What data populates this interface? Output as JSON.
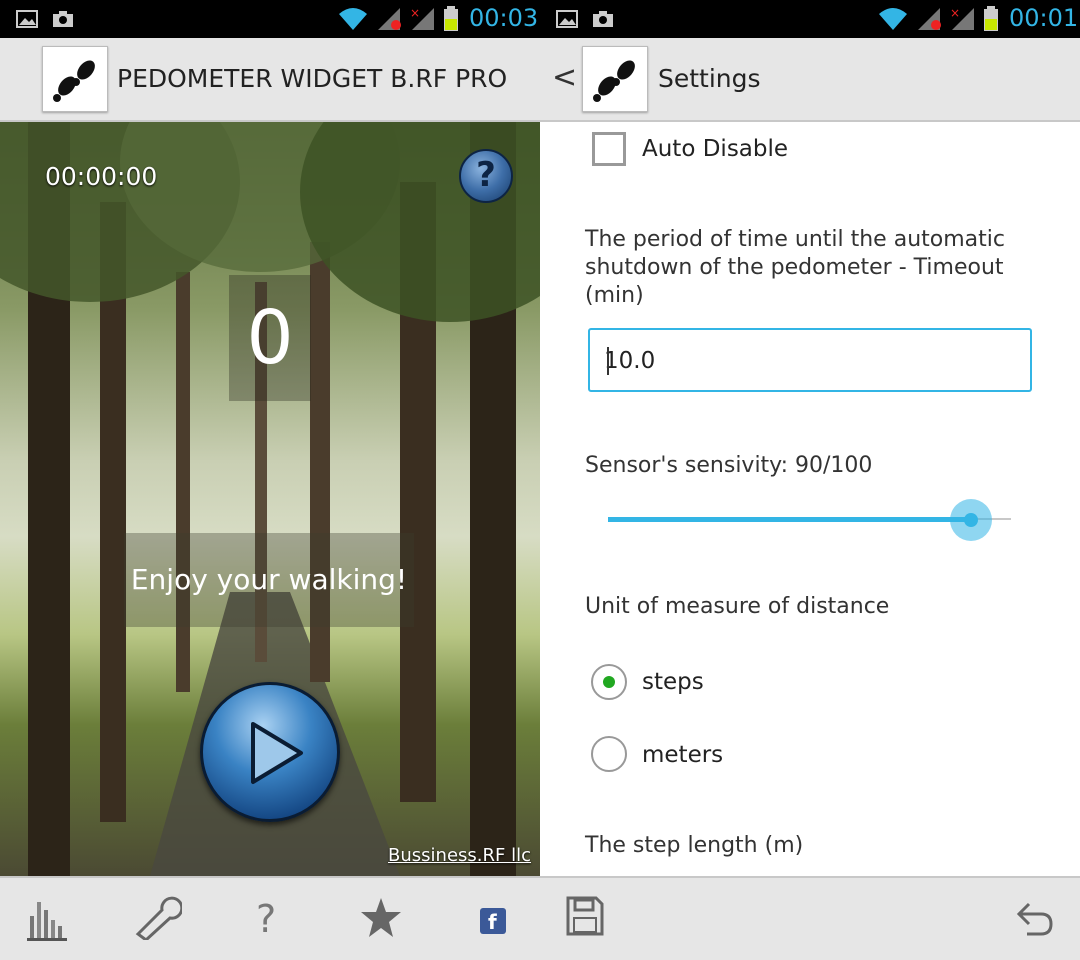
{
  "left": {
    "status": {
      "time": "00:03"
    },
    "app_title": "PEDOMETER WIDGET B.RF PRO",
    "timer": "00:00:00",
    "step_count": "0",
    "message": "Enjoy your walking!",
    "credit": "Bussiness.RF llc",
    "help_icon": "question-icon",
    "play_icon": "play-icon"
  },
  "right": {
    "status": {
      "time": "00:01"
    },
    "title": "Settings",
    "auto_disable_label": "Auto Disable",
    "auto_disable_checked": false,
    "timeout_desc": "The period of time until the automatic shutdown of the pedometer - Timeout (min)",
    "timeout_value": "10.0",
    "sensitivity_label": "Sensor's sensivity: 90/100",
    "sensitivity_value": 90,
    "sensitivity_max": 100,
    "unit_title": "Unit of measure of distance",
    "unit_options": [
      "steps",
      "meters"
    ],
    "unit_selected": "steps",
    "step_length_label": "The step length (m)"
  },
  "bottom_icons": [
    "stats-icon",
    "wrench-icon",
    "help-icon",
    "star-icon",
    "facebook-icon",
    "save-icon",
    "undo-icon"
  ],
  "colors": {
    "accent": "#33b5e5",
    "radio_on": "#21a821",
    "bar_bg": "#e6e6e6"
  }
}
